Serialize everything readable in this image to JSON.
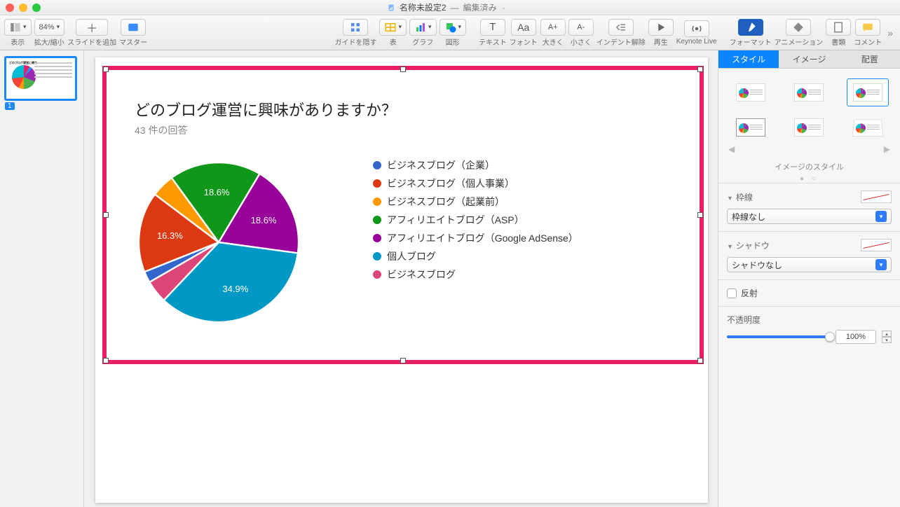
{
  "window": {
    "doc_title": "名称未設定2",
    "doc_state": "編集済み"
  },
  "toolbar": {
    "view": "表示",
    "zoom_value": "84%",
    "zoom": "拡大/縮小",
    "add_slide": "スライドを追加",
    "master": "マスター",
    "hide_guides": "ガイドを隠す",
    "table": "表",
    "chart": "グラフ",
    "shape": "図形",
    "text": "テキスト",
    "font": "フォント",
    "bigger": "大きく",
    "smaller": "小さく",
    "outdent": "インデント解除",
    "play": "再生",
    "keynote_live": "Keynote Live",
    "format": "フォーマット",
    "animation": "アニメーション",
    "document": "書類",
    "comment": "コメント"
  },
  "navigator": {
    "slide_number": "1"
  },
  "inspector": {
    "tab_style": "スタイル",
    "tab_image": "イメージ",
    "tab_arrange": "配置",
    "image_style": "イメージのスタイル",
    "border": "枠線",
    "border_none": "枠線なし",
    "shadow": "シャドウ",
    "shadow_none": "シャドウなし",
    "reflection": "反射",
    "opacity": "不透明度",
    "opacity_value": "100%"
  },
  "chart_data": {
    "type": "pie",
    "title": "どのブログ運営に興味がありますか？",
    "subtitle": "43 件の回答",
    "series": [
      {
        "name": "ビジネスブログ（企業）",
        "value": 2.3,
        "color": "#3366cc",
        "show_label": false
      },
      {
        "name": "ビジネスブログ（個人事業）",
        "value": 16.3,
        "color": "#dc3912",
        "show_label": true
      },
      {
        "name": "ビジネスブログ（起業前）",
        "value": 4.7,
        "color": "#ff9900",
        "show_label": false
      },
      {
        "name": "アフィリエイトブログ（ASP）",
        "value": 18.6,
        "color": "#109618",
        "show_label": true
      },
      {
        "name": "アフィリエイトブログ（Google AdSense）",
        "value": 18.6,
        "color": "#990099",
        "show_label": true
      },
      {
        "name": "個人ブログ",
        "value": 34.9,
        "color": "#0099c6",
        "show_label": true
      },
      {
        "name": "ビジネスブログ",
        "value": 4.6,
        "color": "#dd4477",
        "show_label": false
      }
    ],
    "start_angle_deg": 150
  }
}
